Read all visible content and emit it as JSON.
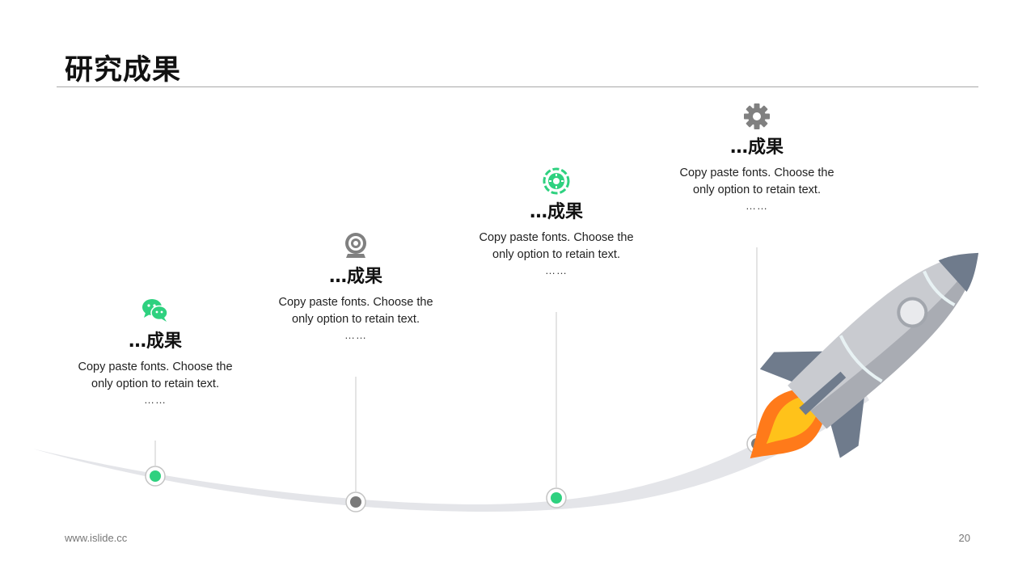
{
  "title": "研究成果",
  "milestones": [
    {
      "icon": "wechat-icon",
      "color": "#2ed17f",
      "heading": "…成果",
      "text": "Copy paste fonts. Choose the only option to retain text.",
      "ellipsis": "……"
    },
    {
      "icon": "webcam-icon",
      "color": "#808080",
      "heading": "…成果",
      "text": "Copy paste fonts. Choose the only option to retain text.",
      "ellipsis": "……"
    },
    {
      "icon": "settings-badge-icon",
      "color": "#2ed17f",
      "heading": "…成果",
      "text": "Copy paste fonts. Choose the only option to retain text.",
      "ellipsis": "……"
    },
    {
      "icon": "gear-icon",
      "color": "#808080",
      "heading": "…成果",
      "text": "Copy paste fonts. Choose the only option to retain text.",
      "ellipsis": "……"
    }
  ],
  "footer": {
    "url": "www.islide.cc",
    "page": "20"
  },
  "colors": {
    "accent_green": "#2ed17f",
    "accent_gray": "#808080",
    "track": "#e3e4e8"
  }
}
